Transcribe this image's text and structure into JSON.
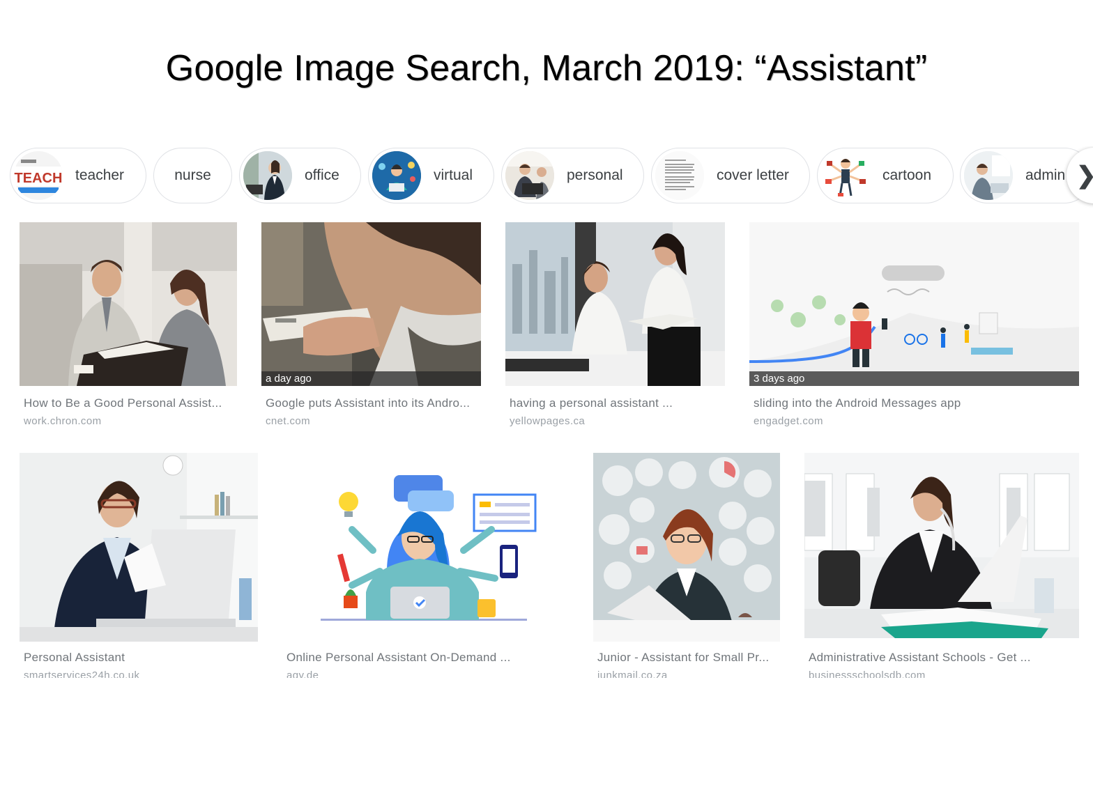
{
  "slide": {
    "title": "Google Image Search, March 2019: “Assistant”"
  },
  "chips": [
    {
      "label": "teacher",
      "thumb_icon": "teacher-thumbnail-icon",
      "thumb_text": "TEACH"
    },
    {
      "label": "nurse"
    },
    {
      "label": "office",
      "thumb_icon": "office-thumbnail-icon"
    },
    {
      "label": "virtual",
      "thumb_icon": "virtual-thumbnail-icon"
    },
    {
      "label": "personal",
      "thumb_icon": "personal-thumbnail-icon"
    },
    {
      "label": "cover letter",
      "thumb_icon": "cover-letter-thumbnail-icon"
    },
    {
      "label": "cartoon",
      "thumb_icon": "cartoon-thumbnail-icon"
    },
    {
      "label": "admin",
      "thumb_icon": "admin-thumbnail-icon"
    }
  ],
  "chip_next": {
    "glyph": "❯",
    "icon": "chevron-right-icon"
  },
  "results": {
    "row1": [
      {
        "title": "How to Be a Good Personal Assist...",
        "domain": "work.chron.com"
      },
      {
        "title": "Google puts Assistant into its Andro...",
        "domain": "cnet.com",
        "age": "a day ago"
      },
      {
        "title": "having a personal assistant ...",
        "domain": "yellowpages.ca"
      },
      {
        "title": "sliding into the Android Messages app",
        "domain": "engadget.com",
        "age": "3 days ago"
      }
    ],
    "row2": [
      {
        "title": "Personal Assistant",
        "domain": "smartservices24h.co.uk"
      },
      {
        "title": "Online Personal Assistant On-Demand ...",
        "domain": "agy.de"
      },
      {
        "title": "Junior - Assistant for Small Pr...",
        "domain": "junkmail.co.za"
      },
      {
        "title": "Administrative Assistant Schools - Get ...",
        "domain": "businessschoolsdb.com"
      }
    ]
  },
  "colors": {
    "chip_border": "#dfe1e5",
    "chip_text": "#3c4043",
    "result_title": "#70757a",
    "result_domain": "#9aa0a6",
    "badge_bg": "#282828"
  }
}
